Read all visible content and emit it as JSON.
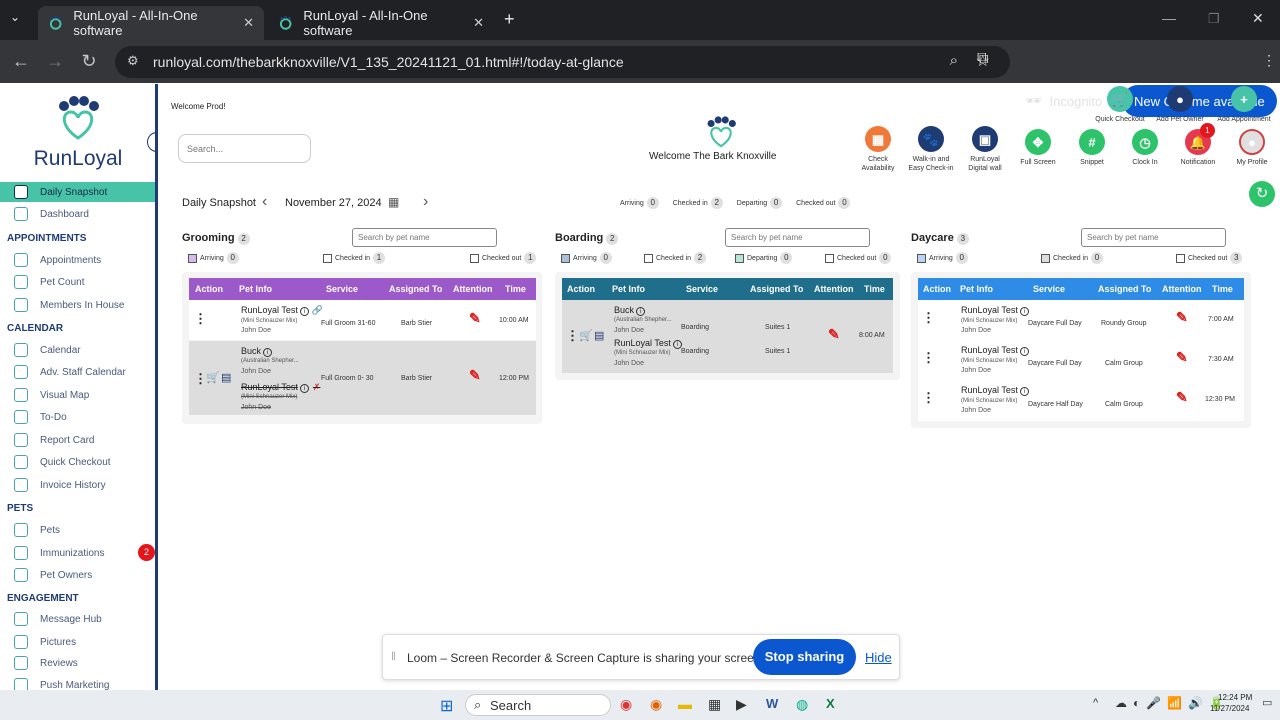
{
  "browser": {
    "tabs": [
      {
        "label": "RunLoyal - All-In-One software"
      },
      {
        "label": "RunLoyal - All-In-One software"
      }
    ],
    "url": "runloyal.com/thebarkknoxville/V1_135_20241121_01.html#!/today-at-glance",
    "incognito": "Incognito",
    "new_chrome": "New Chrome available"
  },
  "app": {
    "logo": "RunLoyal",
    "welcome_user": "Welcome Prod!",
    "search_placeholder": "Search...",
    "welcome_center": "Welcome The Bark Knoxville"
  },
  "sidebar": {
    "items": [
      {
        "label": "Daily Snapshot",
        "active": true
      },
      {
        "label": "Dashboard"
      }
    ],
    "appointments": {
      "title": "APPOINTMENTS",
      "items": [
        "Appointments",
        "Pet Count",
        "Members In House"
      ]
    },
    "calendar": {
      "title": "CALENDAR",
      "items": [
        "Calendar",
        "Adv. Staff Calendar",
        "Visual Map",
        "To-Do",
        "Report Card",
        "Quick Checkout",
        "Invoice History"
      ]
    },
    "pets": {
      "title": "PETS",
      "items": [
        "Pets",
        "Immunizations",
        "Pet Owners"
      ],
      "immunizations_badge": "2"
    },
    "engagement": {
      "title": "ENGAGEMENT",
      "items": [
        "Message Hub",
        "Pictures",
        "Reviews",
        "Push Marketing"
      ]
    }
  },
  "header_buttons": {
    "top": [
      {
        "label": "Quick Checkout",
        "color": "#47c3a7"
      },
      {
        "label": "Add Pet Owner",
        "color": "#1f3b73"
      },
      {
        "label": "Add Appointment",
        "color": "#47c3a7"
      }
    ],
    "bottom": [
      {
        "label": "Check Availability",
        "color": "#f0793a"
      },
      {
        "label": "Walk-in and Easy Check-in",
        "color": "#1f3b73"
      },
      {
        "label": "RunLoyal Digital wall",
        "color": "#1f3b73"
      },
      {
        "label": "Full Screen",
        "color": "#2cc36b"
      },
      {
        "label": "Snippet",
        "color": "#2cc36b"
      },
      {
        "label": "Clock In",
        "color": "#2cc36b"
      },
      {
        "label": "Notification",
        "color": "#e63950"
      },
      {
        "label": "My Profile",
        "color": "#e0e0e0"
      }
    ],
    "notification_badge": "1"
  },
  "snapshot": {
    "title": "Daily Snapshot",
    "date": "November 27, 2024",
    "summary": [
      {
        "label": "Arriving",
        "count": "0"
      },
      {
        "label": "Checked in",
        "count": "2"
      },
      {
        "label": "Departing",
        "count": "0"
      },
      {
        "label": "Checked out",
        "count": "0"
      }
    ]
  },
  "panels": {
    "grooming": {
      "name": "Grooming",
      "count": "2",
      "search": "Search by pet name",
      "color": "#9b59c9",
      "filters": [
        {
          "label": "Arriving",
          "count": "0"
        },
        {
          "label": "Checked in",
          "count": "1"
        },
        {
          "label": "Checked out",
          "count": "1"
        }
      ],
      "headers": [
        "Action",
        "Pet Info",
        "Service",
        "Assigned To",
        "Attention",
        "Time"
      ],
      "rows": [
        {
          "name": "RunLoyal Test",
          "breed": "(Mini Schnauzer Mix)",
          "owner": "John Doe",
          "service": "Full Groom 31-60",
          "assigned": "Barb Stier",
          "time": "10:00 AM"
        },
        {
          "name": "Buck",
          "breed": "(Australian Shepher...",
          "owner": "John Doe",
          "name2": "RunLoyal Test",
          "breed2": "(Mini Schnauzer Mix)",
          "owner2": "John Doe",
          "service": "Full Groom 0- 30",
          "assigned": "Barb Stier",
          "time": "12:00 PM"
        }
      ]
    },
    "boarding": {
      "name": "Boarding",
      "count": "2",
      "search": "Search by pet name",
      "color": "#1f6e8c",
      "filters": [
        {
          "label": "Arriving",
          "count": "0"
        },
        {
          "label": "Checked in",
          "count": "2"
        },
        {
          "label": "Departing",
          "count": "0"
        },
        {
          "label": "Checked out",
          "count": "0"
        }
      ],
      "headers": [
        "Action",
        "Pet Info",
        "Service",
        "Assigned To",
        "Attention",
        "Time"
      ],
      "rows": [
        {
          "name": "Buck",
          "breed": "(Australian Shepher...",
          "owner": "John Doe",
          "service": "Boarding",
          "assigned": "Suites 1",
          "name2": "RunLoyal Test",
          "breed2": "(Mini Schnauzer Mix)",
          "owner2": "John Doe",
          "service2": "Boarding",
          "assigned2": "Suites 1",
          "time": "8:00 AM"
        }
      ]
    },
    "daycare": {
      "name": "Daycare",
      "count": "3",
      "search": "Search by pet name",
      "color": "#2e8be6",
      "filters": [
        {
          "label": "Arriving",
          "count": "0"
        },
        {
          "label": "Checked in",
          "count": "0"
        },
        {
          "label": "Checked out",
          "count": "3"
        }
      ],
      "headers": [
        "Action",
        "Pet Info",
        "Service",
        "Assigned To",
        "Attention",
        "Time"
      ],
      "rows": [
        {
          "name": "RunLoyal Test",
          "breed": "(Mini Schnauzer Mix)",
          "owner": "John Doe",
          "service": "Daycare Full Day",
          "assigned": "Roundy Group",
          "time": "7:00 AM"
        },
        {
          "name": "RunLoyal Test",
          "breed": "(Mini Schnauzer Mix)",
          "owner": "John Doe",
          "service": "Daycare Full Day",
          "assigned": "Calm Group",
          "time": "7:30 AM"
        },
        {
          "name": "RunLoyal Test",
          "breed": "(Mini Schnauzer Mix)",
          "owner": "John Doe",
          "service": "Daycare Half Day",
          "assigned": "Calm Group",
          "time": "12:30 PM"
        }
      ]
    }
  },
  "loom": {
    "message": "Loom – Screen Recorder & Screen Capture is sharing your screen.",
    "stop": "Stop sharing",
    "hide": "Hide"
  },
  "taskbar": {
    "search": "Search",
    "time": "12:24 PM",
    "date": "11/27/2024"
  }
}
